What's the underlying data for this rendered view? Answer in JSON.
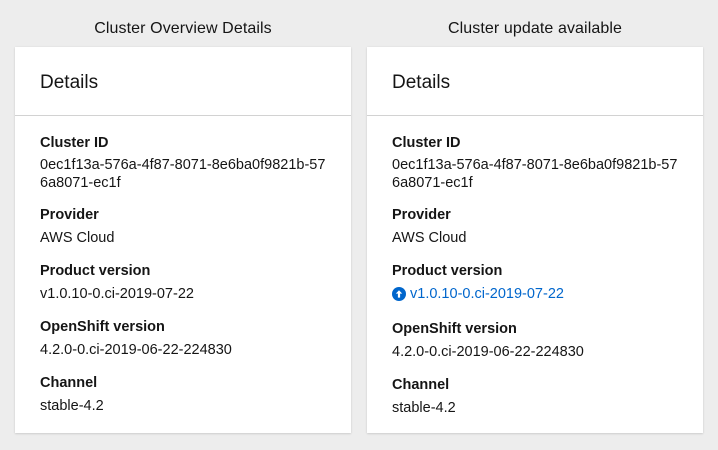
{
  "left": {
    "caption": "Cluster Overview Details",
    "card_title": "Details",
    "fields": {
      "cluster_id": {
        "label": "Cluster ID",
        "value": "0ec1f13a-576a-4f87-8071-8e6ba0f9821b-576a8071-ec1f"
      },
      "provider": {
        "label": "Provider",
        "value": "AWS Cloud"
      },
      "product_version": {
        "label": "Product version",
        "value": "v1.0.10-0.ci-2019-07-22"
      },
      "openshift_version": {
        "label": "OpenShift version",
        "value": "4.2.0-0.ci-2019-06-22-224830"
      },
      "channel": {
        "label": "Channel",
        "value": "stable-4.2"
      }
    }
  },
  "right": {
    "caption": "Cluster update available",
    "card_title": "Details",
    "fields": {
      "cluster_id": {
        "label": "Cluster ID",
        "value": "0ec1f13a-576a-4f87-8071-8e6ba0f9821b-576a8071-ec1f"
      },
      "provider": {
        "label": "Provider",
        "value": "AWS Cloud"
      },
      "product_version": {
        "label": "Product version",
        "value": "v1.0.10-0.ci-2019-07-22",
        "icon": "arrow-circle-up-icon"
      },
      "openshift_version": {
        "label": "OpenShift version",
        "value": "4.2.0-0.ci-2019-06-22-224830"
      },
      "channel": {
        "label": "Channel",
        "value": "stable-4.2"
      }
    }
  },
  "colors": {
    "background": "#ededed",
    "card": "#ffffff",
    "link": "#0066cc",
    "text": "#151515",
    "divider": "#d2d2d2"
  }
}
